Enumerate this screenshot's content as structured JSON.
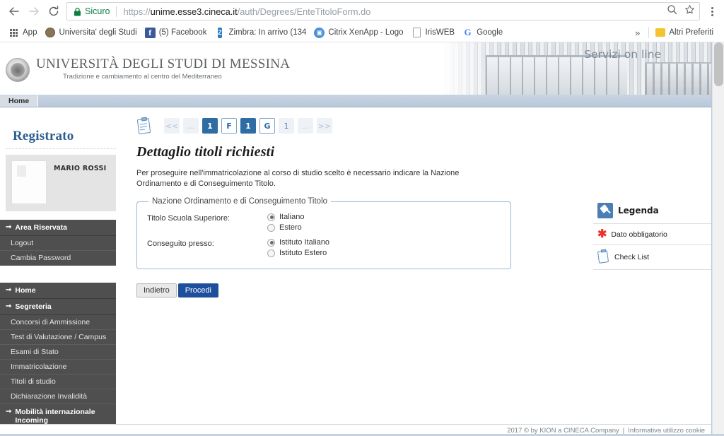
{
  "browser": {
    "nav": {
      "back_label": "back-arrow",
      "forward_label": "forward-arrow",
      "reload_label": "reload"
    },
    "omnibox": {
      "secure_label": "Sicuro",
      "url_scheme": "https://",
      "url_host": "unime.esse3.cineca.it",
      "url_path": "/auth/Degrees/EnteTitoloForm.do",
      "full_url": "https://unime.esse3.cineca.it/auth/Degrees/EnteTitoloForm.do",
      "search_icon": "magnifier-icon",
      "star_icon": "star-icon",
      "menu_icon": "kebab-menu-icon"
    },
    "bookmarks": [
      {
        "label": "App",
        "icon": "apps-grid-icon"
      },
      {
        "label": "Universita' degli Studi",
        "icon": "university-icon"
      },
      {
        "label": "(5) Facebook",
        "icon": "facebook-icon"
      },
      {
        "label": "Zimbra: In arrivo (134",
        "icon": "zimbra-icon"
      },
      {
        "label": "Citrix XenApp - Logo",
        "icon": "citrix-icon"
      },
      {
        "label": "IrisWEB",
        "icon": "document-icon"
      },
      {
        "label": "Google",
        "icon": "google-icon"
      }
    ],
    "bookmarks_overflow": "»",
    "other_bookmarks": {
      "label": "Altri Preferiti",
      "icon": "folder-icon"
    }
  },
  "site_header": {
    "university_name_parts": [
      "U",
      "NIVERSITÀ DEGLI ",
      "S",
      "TUDI DI ",
      "M",
      "ESSINA"
    ],
    "university_name": "UNIVERSITÀ DEGLI STUDI DI MESSINA",
    "tagline": "Tradizione e cambiamento al centro del Mediterraneo",
    "services_label": "Servizi on line",
    "tab_home": "Home"
  },
  "sidebar": {
    "section_title": "Registrato",
    "user_name": "MARIO ROSSI",
    "groups": [
      {
        "header": "Area Riservata",
        "items": [
          "Logout",
          "Cambia Password"
        ]
      },
      {
        "header": "Home",
        "items": []
      },
      {
        "header": "Segreteria",
        "items": [
          "Concorsi di Ammissione",
          "Test di Valutazione / Campus",
          "Esami di Stato",
          "Immatricolazione",
          "Titoli di studio",
          "Dichiarazione Invalidità"
        ]
      },
      {
        "header": "Mobilità internazionale Incoming",
        "items": []
      }
    ]
  },
  "main": {
    "stepper_icon": "checklist-clipboard-icon",
    "steps": [
      {
        "label": "<<",
        "style": "muted"
      },
      {
        "label": "...",
        "style": "muted"
      },
      {
        "label": "1",
        "style": "active"
      },
      {
        "label": "F",
        "style": "outline"
      },
      {
        "label": "1",
        "style": "active"
      },
      {
        "label": "G",
        "style": "outline"
      },
      {
        "label": "1",
        "style": "plain"
      },
      {
        "label": "...",
        "style": "muted"
      },
      {
        "label": ">>",
        "style": "muted"
      }
    ],
    "title": "Dettaglio titoli richiesti",
    "description": "Per proseguire nell'immatricolazione al corso di studio scelto è necessario indicare la Nazione Ordinamento e di Conseguimento Titolo.",
    "fieldset": {
      "legend": "Nazione Ordinamento e di Conseguimento Titolo",
      "rows": [
        {
          "label": "Titolo Scuola Superiore:",
          "options": [
            {
              "label": "Italiano",
              "checked": true
            },
            {
              "label": "Estero",
              "checked": false
            }
          ]
        },
        {
          "label": "Conseguito presso:",
          "options": [
            {
              "label": "Istituto Italiano",
              "checked": true
            },
            {
              "label": "Istituto Estero",
              "checked": false
            }
          ]
        }
      ]
    },
    "buttons": {
      "back": "Indietro",
      "next": "Procedi"
    }
  },
  "legend_panel": {
    "title": "Legenda",
    "title_icon": "pin-icon",
    "rows": [
      {
        "label": "Dato obbligatorio",
        "icon": "asterisk-icon"
      },
      {
        "label": "Check List",
        "icon": "checklist-clipboard-icon"
      }
    ]
  },
  "footer": {
    "copyright": "2017 © by KION a CINECA Company",
    "separator": "|",
    "cookie_link": "Informativa utilizzo cookie"
  },
  "colors": {
    "accent_blue": "#2e6da4",
    "button_blue": "#1e4f9c",
    "sidebar_dark": "#4f4f4f",
    "secure_green": "#0b8043",
    "required_red": "#e8342a",
    "heading_blue": "#2c5d8f"
  }
}
